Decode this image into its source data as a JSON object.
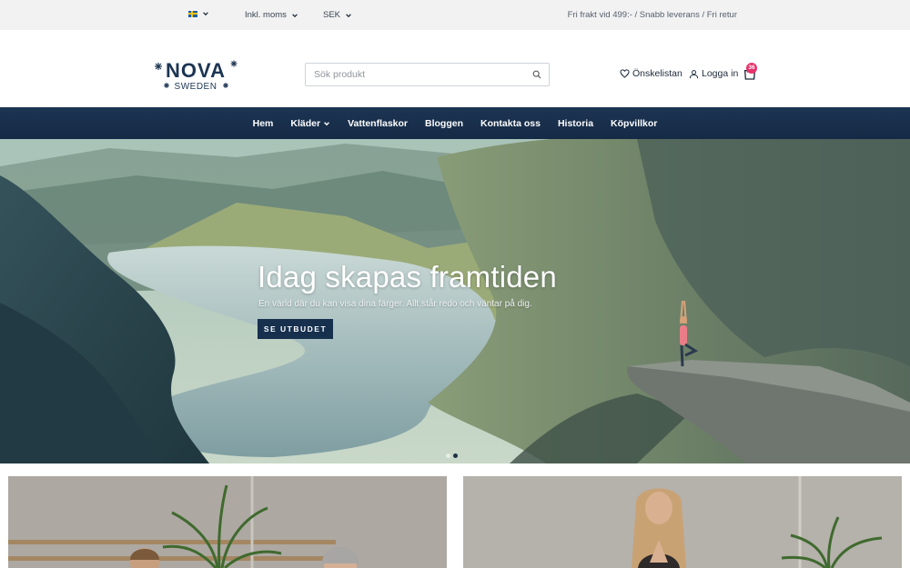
{
  "topbar": {
    "language_selector": {
      "flag_icon": "sweden-flag-icon"
    },
    "tax_selector": {
      "value": "Inkl. moms"
    },
    "currency_selector": {
      "value": "SEK"
    },
    "promo_text": "Fri frakt vid 499:- / Snabb leverans / Fri retur"
  },
  "header": {
    "logo": {
      "brand": "NOVA",
      "tagline": "SWEDEN"
    },
    "search": {
      "placeholder": "Sök produkt",
      "value": ""
    },
    "wishlist_label": "Önskelistan",
    "login_label": "Logga in",
    "cart": {
      "count": "36",
      "icon": "shopping-bag-icon"
    }
  },
  "nav": {
    "items": [
      {
        "label": "Hem"
      },
      {
        "label": "Kläder",
        "has_dropdown": true
      },
      {
        "label": "Vattenflaskor"
      },
      {
        "label": "Bloggen"
      },
      {
        "label": "Kontakta oss"
      },
      {
        "label": "Historia"
      },
      {
        "label": "Köpvillkor"
      }
    ]
  },
  "hero": {
    "title": "Idag skapas framtiden",
    "subtitle": "En värld där du kan visa dina färger. Allt står redo och väntar på dig.",
    "cta_label": "SE UTBUDET",
    "slides_total": 2,
    "active_slide": 2
  },
  "colors": {
    "nav_bg": "#1c3553",
    "cta_bg": "#16304e",
    "badge": "#e6336b",
    "topbar_bg": "#f2f2f3"
  }
}
